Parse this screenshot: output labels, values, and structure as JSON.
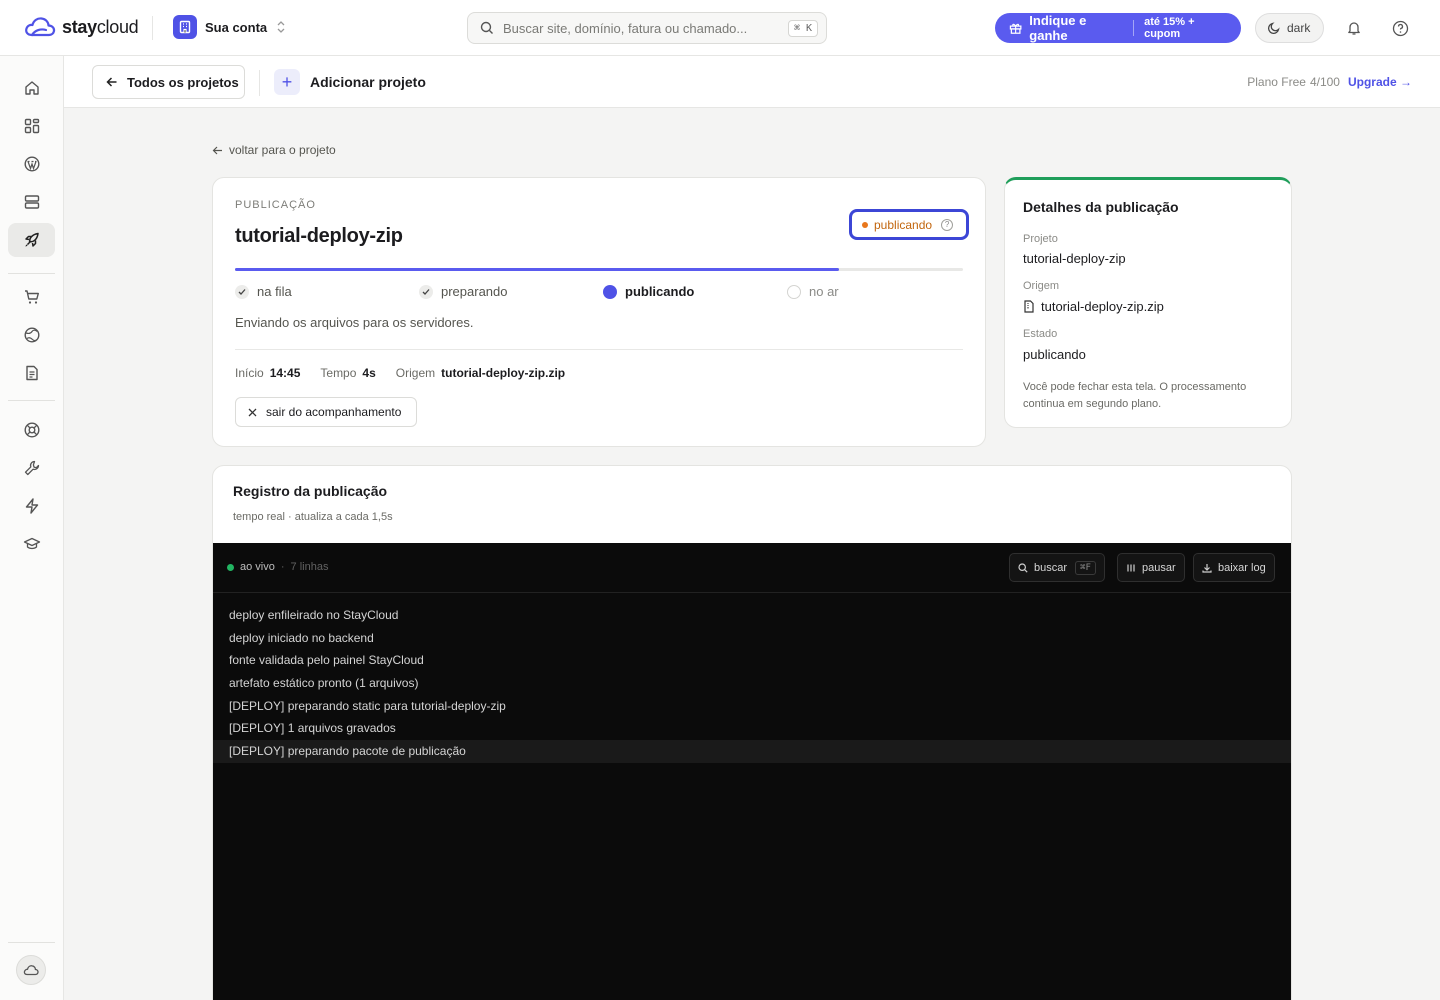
{
  "topbar": {
    "brand_bold": "stay",
    "brand_light": "cloud",
    "account_label": "Sua conta",
    "search_placeholder": "Buscar site, domínio, fatura ou chamado...",
    "search_shortcut": "⌘ K",
    "promo_main": "Indique e ganhe",
    "promo_sub": "até 15% + cupom",
    "theme_label": "dark"
  },
  "sidebar": {
    "icons": [
      "home-icon",
      "apps-icon",
      "wordpress-icon",
      "server-icon",
      "rocket-icon",
      "cart-icon",
      "globe-icon",
      "document-icon",
      "support-icon",
      "wrench-icon",
      "lightning-icon",
      "graduation-icon"
    ],
    "active": "rocket-icon"
  },
  "subheader": {
    "all_projects": "Todos os projetos",
    "add_project": "Adicionar projeto",
    "plan_label": "Plano Free",
    "plan_usage": "4/100",
    "upgrade": "Upgrade →"
  },
  "back_link": "voltar para o projeto",
  "publication": {
    "eyebrow": "PUBLICAÇÃO",
    "title": "tutorial-deploy-zip",
    "status": "publicando",
    "progress": 0.83,
    "steps": [
      {
        "label": "na fila",
        "state": "done"
      },
      {
        "label": "preparando",
        "state": "done"
      },
      {
        "label": "publicando",
        "state": "current"
      },
      {
        "label": "no ar",
        "state": "pending"
      }
    ],
    "description": "Enviando os arquivos para os servidores.",
    "meta": {
      "start_label": "Início",
      "start_value": "14:45",
      "time_label": "Tempo",
      "time_value": "4s",
      "origin_label": "Origem",
      "origin_value": "tutorial-deploy-zip.zip"
    },
    "exit_button": "sair do acompanhamento"
  },
  "details": {
    "title": "Detalhes da publicação",
    "project_label": "Projeto",
    "project_value": "tutorial-deploy-zip",
    "origin_label": "Origem",
    "origin_value": "tutorial-deploy-zip.zip",
    "state_label": "Estado",
    "state_value": "publicando",
    "note": "Você pode fechar esta tela. O processamento continua em segundo plano."
  },
  "log": {
    "title": "Registro da publicação",
    "subtitle": "tempo real · atualiza a cada 1,5s",
    "live_label": "ao vivo",
    "lines_count": "7 linhas",
    "search_label": "buscar",
    "search_shortcut": "⌘F",
    "pause_label": "pausar",
    "download_label": "baixar log",
    "lines": [
      "deploy enfileirado no StayCloud",
      "deploy iniciado no backend",
      "fonte validada pelo painel StayCloud",
      "artefato estático pronto (1 arquivos)",
      "[DEPLOY] preparando static para tutorial-deploy-zip",
      "[DEPLOY] 1 arquivos gravados",
      "[DEPLOY] preparando pacote de publicação"
    ]
  },
  "colors": {
    "accent": "#5a5bef",
    "status_orange": "#e8771c",
    "live_green": "#22b562",
    "details_border": "#1f9e5a"
  }
}
